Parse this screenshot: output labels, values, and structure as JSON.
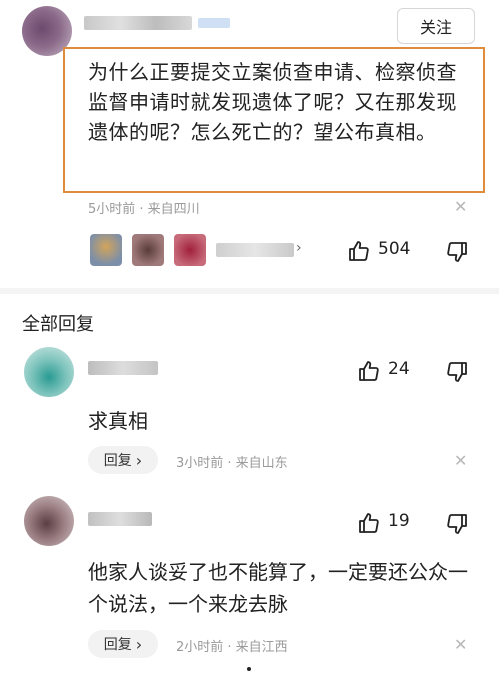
{
  "main_comment": {
    "follow_label": "关注",
    "text": "为什么正要提交立案侦查申请、检察侦查监督申请时就发现遗体了呢？又在那发现遗体的呢？怎么死亡的？望公布真相。",
    "meta": "5小时前 · 来自四川",
    "like_count": "504"
  },
  "section_title": "全部回复",
  "replies": [
    {
      "text": "求真相",
      "meta": "3小时前 · 来自山东",
      "like_count": "24",
      "reply_label": "回复"
    },
    {
      "text": "他家人谈妥了也不能算了，一定要还公众一个说法，一个来龙去脉",
      "meta": "2小时前 · 来自江西",
      "like_count": "19",
      "reply_label": "回复"
    }
  ],
  "colors": {
    "highlight_border": "#e08a3c",
    "muted_text": "#9a9a9a"
  }
}
